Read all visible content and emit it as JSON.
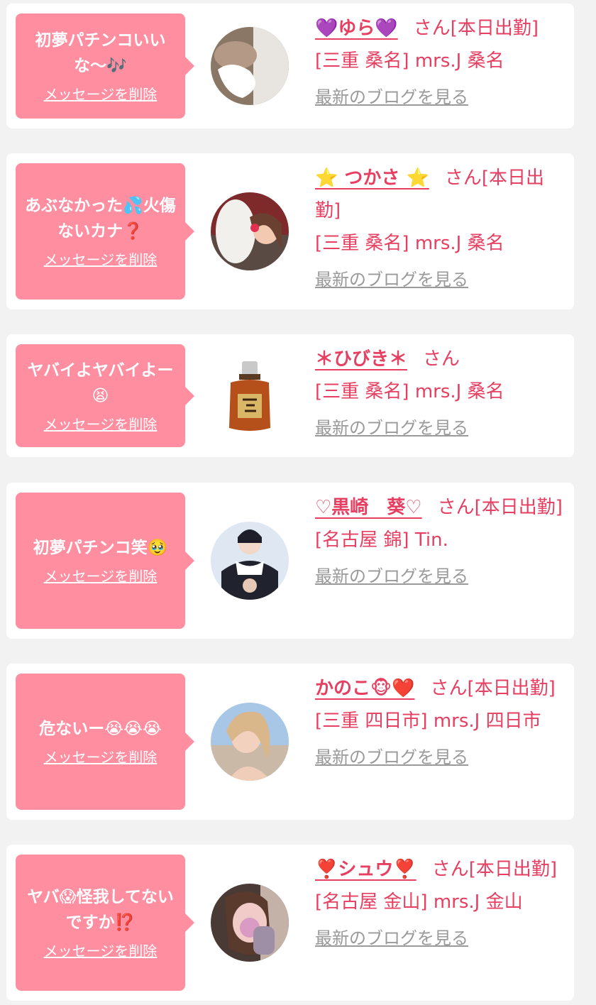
{
  "delete_label": "メッセージを削除",
  "blog_label": "最新のブログを見る",
  "san_label": "さん",
  "colors": {
    "accent": "#e63f61",
    "bubble": "#ff8ea0",
    "card": "#ffffff",
    "background": "#f2f2f2",
    "link_gray": "#9a9a9a"
  },
  "items": [
    {
      "message": "初夢パチンコいいな〜🎶",
      "name": "💜ゆら💜",
      "status": "[本日出勤]",
      "location": "[三重 桑名] mrs.J 桑名",
      "avatar_icon": "avatar-photo-yura"
    },
    {
      "message": "あぶなかった💦火傷ないカナ❓",
      "name": "⭐️ つかさ ⭐️",
      "status": "[本日出勤]",
      "location": "[三重 桑名] mrs.J 桑名",
      "avatar_icon": "avatar-photo-tsukasa"
    },
    {
      "message": "ヤバイよヤバイよー😫",
      "name": "＊ひびき＊",
      "status": "",
      "location": "[三重 桑名] mrs.J 桑名",
      "avatar_icon": "avatar-photo-hibiki"
    },
    {
      "message": "初夢パチンコ笑🥹",
      "name": "♡黒崎　葵♡",
      "status": "[本日出勤]",
      "location": "[名古屋 錦] Tin.",
      "avatar_icon": "avatar-photo-kurosaki"
    },
    {
      "message": "危ないー😭😭😭",
      "name": "かのこ🐵❤️",
      "status": "[本日出勤]",
      "location": "[三重 四日市] mrs.J 四日市",
      "avatar_icon": "avatar-photo-kanoko"
    },
    {
      "message": "ヤバ😱怪我してないですか⁉️",
      "name": "❣️シュウ❣️",
      "status": "[本日出勤]",
      "location": "[名古屋 金山] mrs.J 金山",
      "avatar_icon": "avatar-photo-shuu"
    }
  ]
}
